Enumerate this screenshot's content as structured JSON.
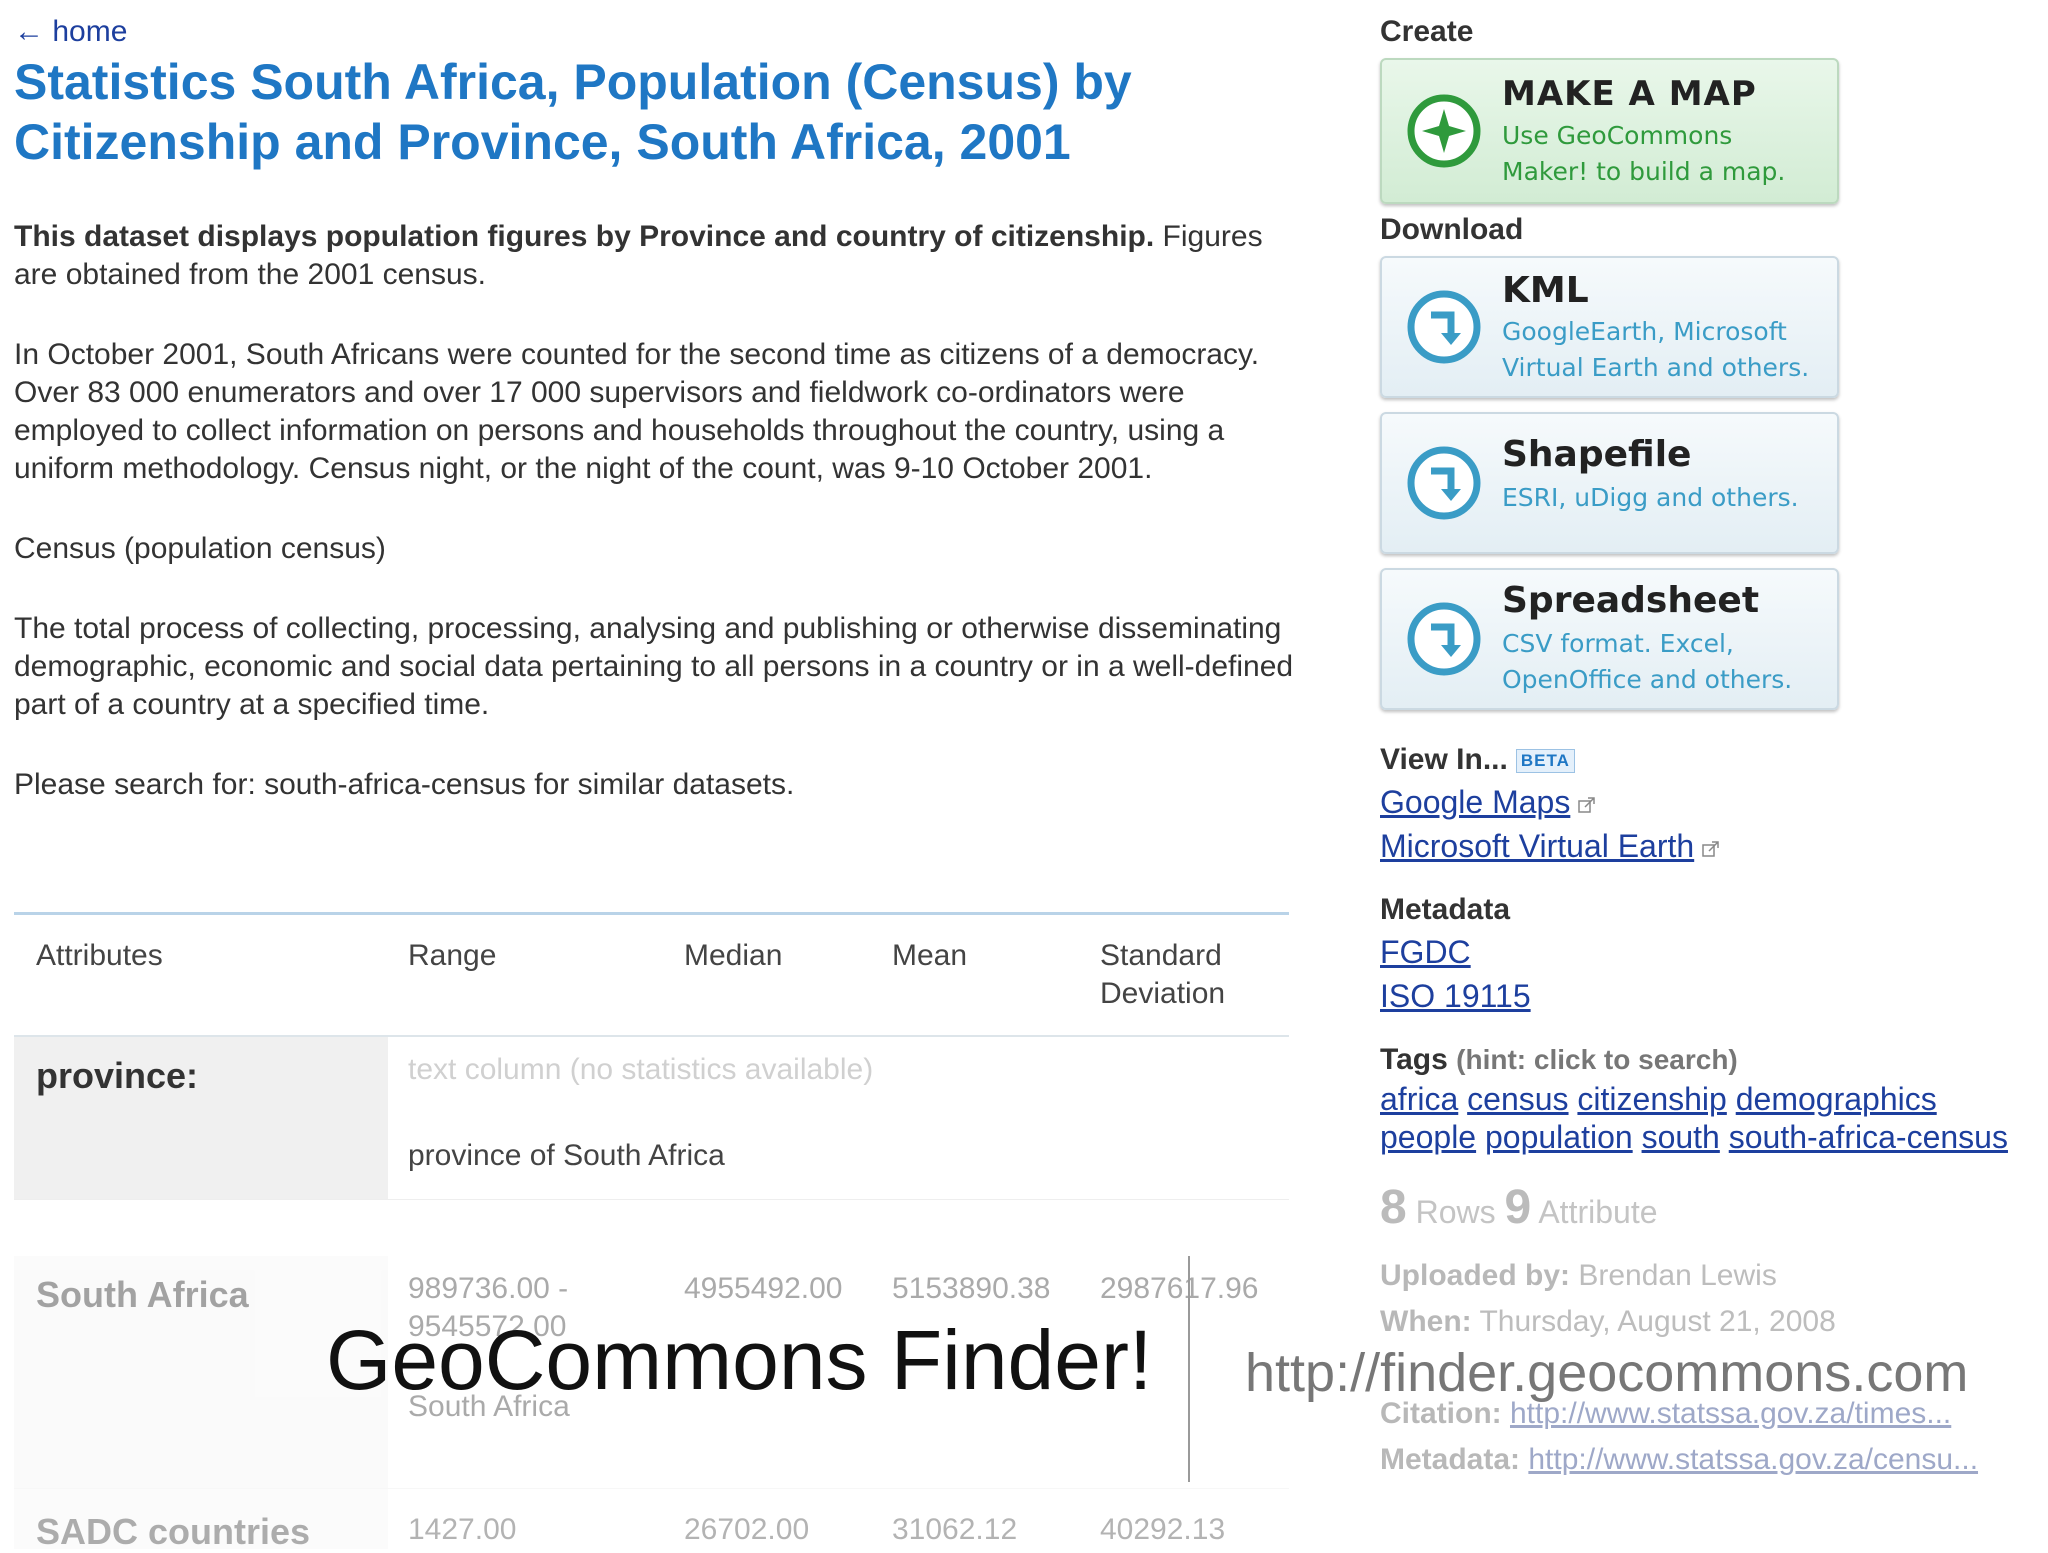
{
  "nav": {
    "home": "← home"
  },
  "title": "Statistics South Africa, Population (Census) by Citizenship and Province, South Africa, 2001",
  "description": {
    "lead_bold": "This dataset displays population figures by Province and country of citizenship.",
    "lead_rest": " Figures are obtained from the 2001 census.",
    "paragraph1": "In October 2001, South Africans were counted for the second time as citizens of a democracy. Over 83 000 enumerators and over 17 000 supervisors and fieldwork co-ordinators were employed to collect information on persons and households throughout the country, using a uniform methodology. Census night, or the night of the count, was 9-10 October 2001.",
    "paragraph2": "Census (population census)",
    "paragraph3": "The total process of collecting, processing, analysing and publishing or otherwise disseminating demographic, economic and social data pertaining to all persons in a country or in a well-defined part of a country at a specified time.",
    "search_hint": "Please search for: south-africa-census for similar datasets."
  },
  "stats_table": {
    "headers": [
      "Attributes",
      "Range",
      "Median",
      "Mean",
      "Standard",
      "Deviation"
    ],
    "rows": [
      {
        "label": "province:",
        "note": "text column (no statistics available)",
        "desc": "province of South Africa"
      },
      {
        "label": "South Africa",
        "range_1": "989736.00 -",
        "range_2": "9545572.00",
        "median": "4955492.00",
        "mean": "5153890.38",
        "std": "2987617.96",
        "desc": "South Africa"
      },
      {
        "label": "SADC countries",
        "range_1": "1427.00",
        "median": "26702.00",
        "mean": "31062.12",
        "std": "40292.13"
      }
    ]
  },
  "sidebar": {
    "create_head": "Create",
    "make_map": {
      "title": "MAKE A MAP",
      "line1": "Use GeoCommons",
      "line2": "Maker! to build a map."
    },
    "download_head": "Download",
    "kml": {
      "title": "KML",
      "line1": "GoogleEarth, Microsoft",
      "line2": "Virtual Earth and others."
    },
    "shapefile": {
      "title": "Shapefile",
      "line1": "ESRI, uDigg and others."
    },
    "spreadsheet": {
      "title": "Spreadsheet",
      "line1": "CSV format. Excel,",
      "line2": "OpenOffice and others."
    },
    "view_in_head": "View In...",
    "beta": "BETA",
    "view_links": [
      "Google Maps",
      "Microsoft Virtual Earth"
    ],
    "metadata_head": "Metadata",
    "metadata_links": [
      "FGDC",
      "ISO 19115"
    ],
    "tags_head": "Tags",
    "tags_hint": "(hint: click to search)",
    "tags_row1": [
      "africa",
      "census",
      "citizenship",
      "demographics"
    ],
    "tags_row2": [
      "people",
      "population",
      "south",
      "south-africa-census"
    ],
    "rows_count": "8",
    "rows_label": "Rows",
    "attr_count": "9",
    "attr_label": "Attribute",
    "uploaded_label": "Uploaded by:",
    "uploaded_value": "Brendan Lewis",
    "when_label": "When:",
    "when_value": "Thursday, August 21, 2008",
    "citation_label": "Citation:",
    "citation_value": "http://www.statssa.gov.za/times...",
    "metadata_label": "Metadata:",
    "metadata_value": "http://www.statssa.gov.za/censu..."
  },
  "overlay": {
    "title": "GeoCommons Finder!",
    "url": "http://finder.geocommons.com"
  },
  "colors": {
    "title_blue": "#1f77c4",
    "link_blue": "#1d3f9e",
    "create_green": "#2f9a3c",
    "download_teal": "#3a9cc6"
  }
}
